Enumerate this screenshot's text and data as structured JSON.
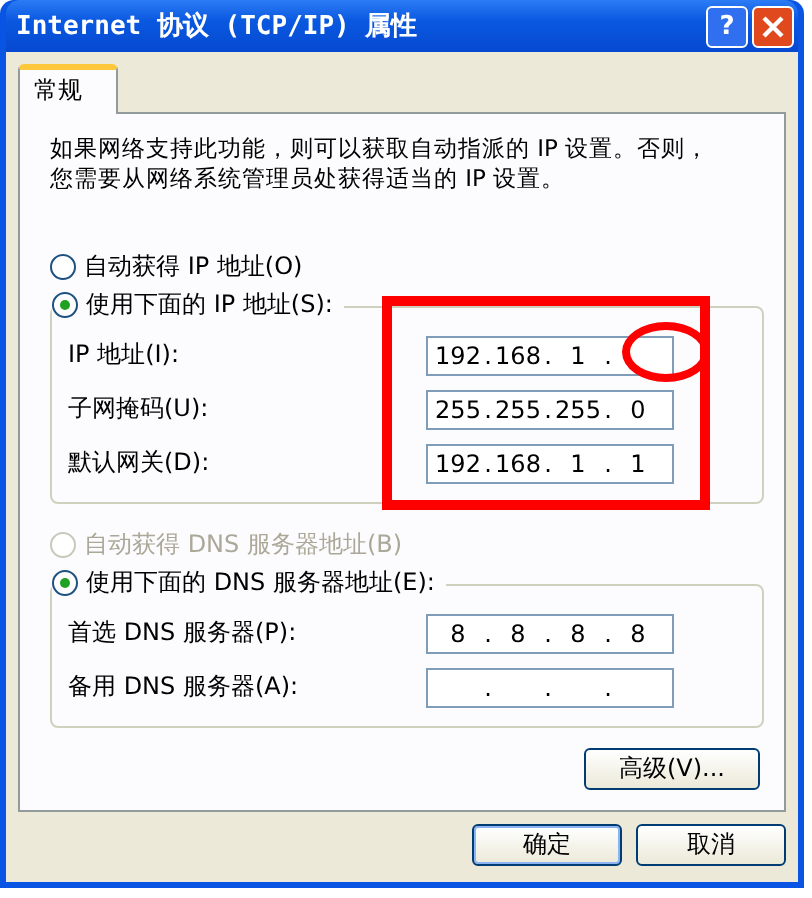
{
  "window": {
    "title": "Internet 协议 (TCP/IP) 属性",
    "help": "?"
  },
  "tabs": [
    {
      "label": "常规",
      "selected": true
    }
  ],
  "description": "如果网络支持此功能，则可以获取自动指派的 IP 设置。否则，您需要从网络系统管理员处获得适当的 IP 设置。",
  "octet_separator": ".",
  "ip_section": {
    "auto_option": {
      "label": "自动获得 IP 地址(O)",
      "selected": false,
      "disabled": false
    },
    "manual_option": {
      "label": "使用下面的 IP 地址(S):",
      "selected": true,
      "disabled": false
    },
    "fields": [
      {
        "label": "IP 地址(I):",
        "octets": [
          "192",
          "168",
          "1"
        ]
      },
      {
        "label": "子网掩码(U):",
        "octets": [
          "255",
          "255",
          "255",
          "0"
        ]
      },
      {
        "label": "默认网关(D):",
        "octets": [
          "192",
          "168",
          "1",
          "1"
        ]
      }
    ]
  },
  "dns_section": {
    "auto_option": {
      "label": "自动获得 DNS 服务器地址(B)",
      "selected": false,
      "disabled": true
    },
    "manual_option": {
      "label": "使用下面的 DNS 服务器地址(E):",
      "selected": true,
      "disabled": false
    },
    "fields": [
      {
        "label": "首选 DNS 服务器(P):",
        "octets": [
          "8",
          "8",
          "8",
          "8"
        ]
      },
      {
        "label": "备用 DNS 服务器(A):"
      }
    ]
  },
  "advanced_button": "高级(V)...",
  "buttons": [
    "确定",
    "取消"
  ],
  "annotations": [
    {
      "kind": "rectangle"
    },
    {
      "kind": "ellipse"
    }
  ]
}
